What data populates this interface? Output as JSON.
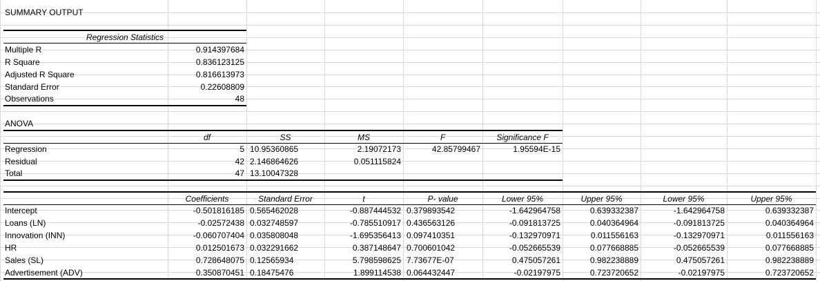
{
  "title": "SUMMARY OUTPUT",
  "regression_statistics": {
    "header": "Regression Statistics",
    "rows": [
      {
        "label": "Multiple R",
        "value": "0.914397684"
      },
      {
        "label": "R Square",
        "value": "0.836123125"
      },
      {
        "label": "Adjusted R Square",
        "value": "0.816613973"
      },
      {
        "label": "Standard Error",
        "value": "0.22608809"
      },
      {
        "label": "Observations",
        "value": "48"
      }
    ]
  },
  "anova": {
    "title": "ANOVA",
    "headers": [
      "df",
      "SS",
      "MS",
      "F",
      "Significance F"
    ],
    "rows": [
      {
        "label": "Regression",
        "cells": [
          "5",
          "10.95360865",
          "2.19072173",
          "42.85799467",
          "1.95594E-15"
        ]
      },
      {
        "label": "Residual",
        "cells": [
          "42",
          "2.146864626",
          "0.051115824",
          "",
          ""
        ]
      },
      {
        "label": "Total",
        "cells": [
          "47",
          "13.10047328",
          "",
          "",
          ""
        ]
      }
    ]
  },
  "coefficients": {
    "headers": [
      "Coefficients",
      "Standard Error",
      "t",
      "P- value",
      "Lower 95%",
      "Upper 95%",
      "Lower 95%",
      "Upper 95%"
    ],
    "rows": [
      {
        "label": "Intercept",
        "cells": [
          "-0.501816185",
          "0.565462028",
          "-0.887444532",
          "0.379893542",
          "-1.642964758",
          "0.639332387",
          "-1.642964758",
          "0.639332387"
        ]
      },
      {
        "label": "Loans (LN)",
        "cells": [
          "-0.02572438",
          "0.032748597",
          "-0.785510917",
          "0.436563126",
          "-0.091813725",
          "0.040364964",
          "-0.091813725",
          "0.040364964"
        ]
      },
      {
        "label": "Innovation (INN)",
        "cells": [
          "-0.060707404",
          "0.035808048",
          "-1.695356413",
          "0.097410351",
          "-0.132970971",
          "0.011556163",
          "-0.132970971",
          "0.011556163"
        ]
      },
      {
        "label": "HR",
        "cells": [
          "0.012501673",
          "0.032291662",
          "0.387148647",
          "0.700601042",
          "-0.052665539",
          "0.077668885",
          "-0.052665539",
          "0.077668885"
        ]
      },
      {
        "label": "Sales (SL)",
        "cells": [
          "0.728648075",
          "0.12565934",
          "5.798598625",
          "7.73677E-07",
          "0.475057261",
          "0.982238889",
          "0.475057261",
          "0.982238889"
        ]
      },
      {
        "label": "Advertisement (ADV)",
        "cells": [
          "0.350870451",
          "0.18475476",
          "1.899114538",
          "0.064432447",
          "-0.02197975",
          "0.723720652",
          "-0.02197975",
          "0.723720652"
        ]
      }
    ]
  }
}
